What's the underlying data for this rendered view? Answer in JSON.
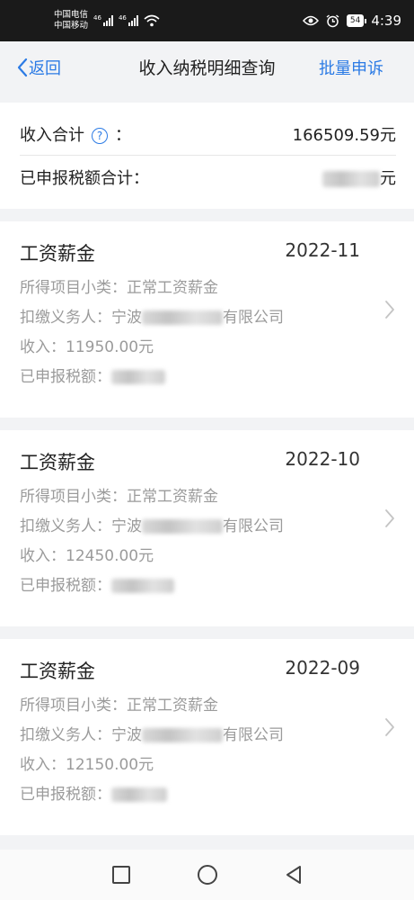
{
  "status_bar": {
    "carrier1": "中国电信",
    "carrier2": "中国移动",
    "signal_labels": [
      "46",
      "46"
    ],
    "battery": "54",
    "time": "4:39"
  },
  "nav": {
    "back_label": "返回",
    "title": "收入纳税明细查询",
    "batch_label": "批量申诉"
  },
  "summary": {
    "income_total_label": "收入合计",
    "colon": "：",
    "income_total_value": "166509.59元",
    "declared_tax_total_label": "已申报税额合计：",
    "declared_tax_total_unit": "元"
  },
  "records": [
    {
      "title": "工资薪金",
      "date": "2022-11",
      "subcategory_label": "所得项目小类：",
      "subcategory": "正常工资薪金",
      "withholder_label": "扣缴义务人：",
      "withholder_prefix": "宁波",
      "withholder_suffix": "有限公司",
      "income_label": "收入：",
      "income": "11950.00元",
      "declared_tax_label": "已申报税额："
    },
    {
      "title": "工资薪金",
      "date": "2022-10",
      "subcategory_label": "所得项目小类：",
      "subcategory": "正常工资薪金",
      "withholder_label": "扣缴义务人：",
      "withholder_prefix": "宁波",
      "withholder_suffix": "有限公司",
      "income_label": "收入：",
      "income": "12450.00元",
      "declared_tax_label": "已申报税额："
    },
    {
      "title": "工资薪金",
      "date": "2022-09",
      "subcategory_label": "所得项目小类：",
      "subcategory": "正常工资薪金",
      "withholder_label": "扣缴义务人：",
      "withholder_prefix": "宁波",
      "withholder_suffix": "有限公司",
      "income_label": "收入：",
      "income": "12150.00元",
      "declared_tax_label": "已申报税额："
    }
  ],
  "icons": {
    "back": "chevron-left-icon",
    "help": "question-circle-icon",
    "row_arrow": "chevron-right-icon",
    "nav_recent": "square-icon",
    "nav_home": "circle-icon",
    "nav_back": "triangle-back-icon"
  },
  "colors": {
    "accent": "#2c7be5",
    "secondary_text": "#9b9b9b",
    "background": "#f2f3f5"
  }
}
